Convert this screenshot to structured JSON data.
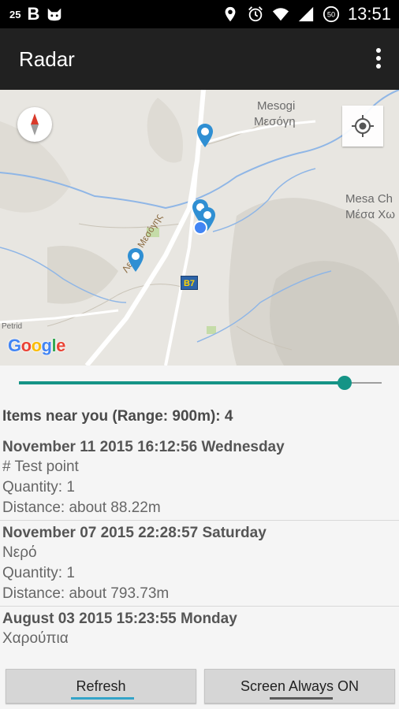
{
  "status_bar": {
    "battery_left": "25",
    "battery_right": "50",
    "time": "13:51",
    "icons": [
      "b-logo-icon",
      "cat-icon",
      "location-icon",
      "alarm-icon",
      "wifi-icon",
      "signal-icon",
      "battery-icon"
    ]
  },
  "app_bar": {
    "title": "Radar",
    "overflow_icon": "more-vert-icon"
  },
  "map": {
    "labels": {
      "mesogi_latin": "Mesogi",
      "mesogi_greek": "Μεσόγη",
      "mesa_latin": "Mesa Ch",
      "mesa_greek": "Μέσα Χω",
      "road_name": "Λεωφ. Μεσόγης",
      "road_shield": "B7",
      "road_shield_2": "B7",
      "edge_label": "Petrid",
      "google_logo": "Google"
    },
    "colors": {
      "pin": "#2f8fd3",
      "water": "#8fb6e6",
      "road": "#ffffff",
      "accent": "#159486"
    }
  },
  "range_slider": {
    "value_fraction": 0.9,
    "range_m": 900
  },
  "summary": "Items near you (Range: 900m): 4",
  "items": [
    {
      "date": "November 11 2015 16:12:56 Wednesday",
      "name": "# Test point",
      "quantity": "Quantity: 1",
      "distance": "Distance: about 88.22m"
    },
    {
      "date": "November 07 2015 22:28:57 Saturday",
      "name": "Νερό",
      "quantity": "Quantity: 1",
      "distance": "Distance: about 793.73m"
    },
    {
      "date": "August 03 2015 15:23:55 Monday",
      "name": "Χαρούπια"
    }
  ],
  "buttons": {
    "refresh": "Refresh",
    "screen_always_on": "Screen Always ON"
  }
}
